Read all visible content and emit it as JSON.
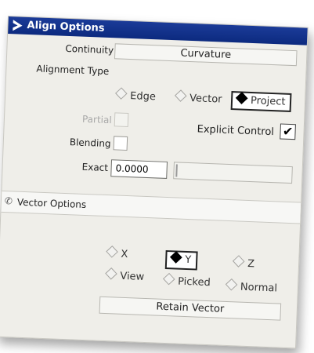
{
  "window": {
    "title": "Align Options",
    "accent": "#1b3b98"
  },
  "continuity": {
    "label": "Continuity",
    "value": "Curvature"
  },
  "alignment_type": {
    "label": "Alignment Type",
    "options": [
      "Edge",
      "Vector",
      "Project"
    ],
    "selected": "Project"
  },
  "partial": {
    "label": "Partial"
  },
  "explicit_control": {
    "label": "Explicit Control",
    "checked": true,
    "mark": "✔"
  },
  "blending": {
    "label": "Blending"
  },
  "exact": {
    "label": "Exact",
    "value": "0.0000"
  },
  "vector_options": {
    "header": "Vector Options",
    "options": [
      "X",
      "Y",
      "Z",
      "View",
      "Picked",
      "Normal"
    ],
    "selected": "Y",
    "retain_label": "Retain Vector"
  }
}
